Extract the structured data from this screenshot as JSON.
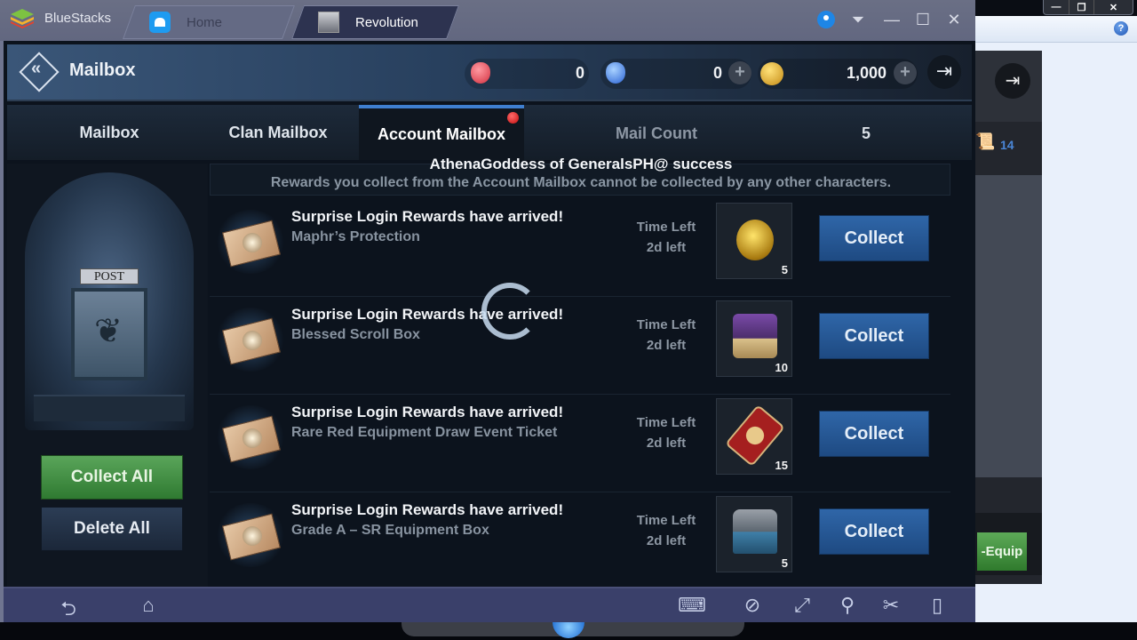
{
  "bluestacks": {
    "app_name": "BlueStacks",
    "tabs": [
      {
        "label": "Home",
        "icon": "home-icon"
      },
      {
        "label": "Revolution",
        "icon": "revolution-game-icon",
        "active": true
      }
    ],
    "window_controls": [
      "location-icon",
      "menu-dropdown-icon",
      "minimize-icon",
      "maximize-icon",
      "close-icon"
    ],
    "accent_color": "#1e86e6"
  },
  "header": {
    "title": "Mailbox",
    "back_icon": "back-diamond-icon",
    "currencies": [
      {
        "icon": "red-gem-icon",
        "value": "0"
      },
      {
        "icon": "blue-gem-icon",
        "value": "0",
        "has_plus": true
      },
      {
        "icon": "gold-coin-icon",
        "value": "1,000",
        "has_plus": true
      }
    ],
    "exit_icon": "exit-door-icon"
  },
  "tabs": {
    "items": [
      {
        "label": "Mailbox"
      },
      {
        "label": "Clan Mailbox"
      },
      {
        "label": "Account Mailbox",
        "active": true,
        "has_notification": true
      }
    ],
    "mail_count_label": "Mail Count",
    "mail_count_value": "5"
  },
  "sidebar": {
    "post_sign": "POST",
    "collect_all_label": "Collect All",
    "delete_all_label": "Delete All"
  },
  "notice": {
    "success": "AthenaGoddess of GeneralsPH@ success",
    "info": "Rewards you collect from the Account Mailbox cannot be collected by any other characters."
  },
  "mails": [
    {
      "title": "Surprise Login Rewards have arrived!",
      "subtitle": "Maphr’s Protection",
      "time_label": "Time Left",
      "time_value": "2d left",
      "item_icon": "golden-amulet-icon",
      "item_count": "5",
      "button": "Collect"
    },
    {
      "title": "Surprise Login Rewards have arrived!",
      "subtitle": "Blessed Scroll Box",
      "time_label": "Time Left",
      "time_value": "2d left",
      "item_icon": "scroll-chest-icon",
      "item_count": "10",
      "button": "Collect"
    },
    {
      "title": "Surprise Login Rewards have arrived!",
      "subtitle": "Rare Red Equipment Draw Event Ticket",
      "time_label": "Time Left",
      "time_value": "2d left",
      "item_icon": "red-ticket-icon",
      "item_count": "15",
      "button": "Collect"
    },
    {
      "title": "Surprise Login Rewards have arrived!",
      "subtitle": "Grade A – SR Equipment Box",
      "time_label": "Time Left",
      "time_value": "2d left",
      "item_icon": "equipment-box-icon",
      "item_count": "5",
      "button": "Collect"
    }
  ],
  "background_window": {
    "scroll_count": "14",
    "equip_button": "-Equip",
    "help_icon": "?"
  },
  "android_nav": {
    "left": [
      "back-icon",
      "home-icon"
    ],
    "right": [
      "keyboard-icon",
      "hide-icon",
      "fullscreen-icon",
      "location-pin-icon",
      "scissors-icon",
      "shake-device-icon"
    ]
  }
}
